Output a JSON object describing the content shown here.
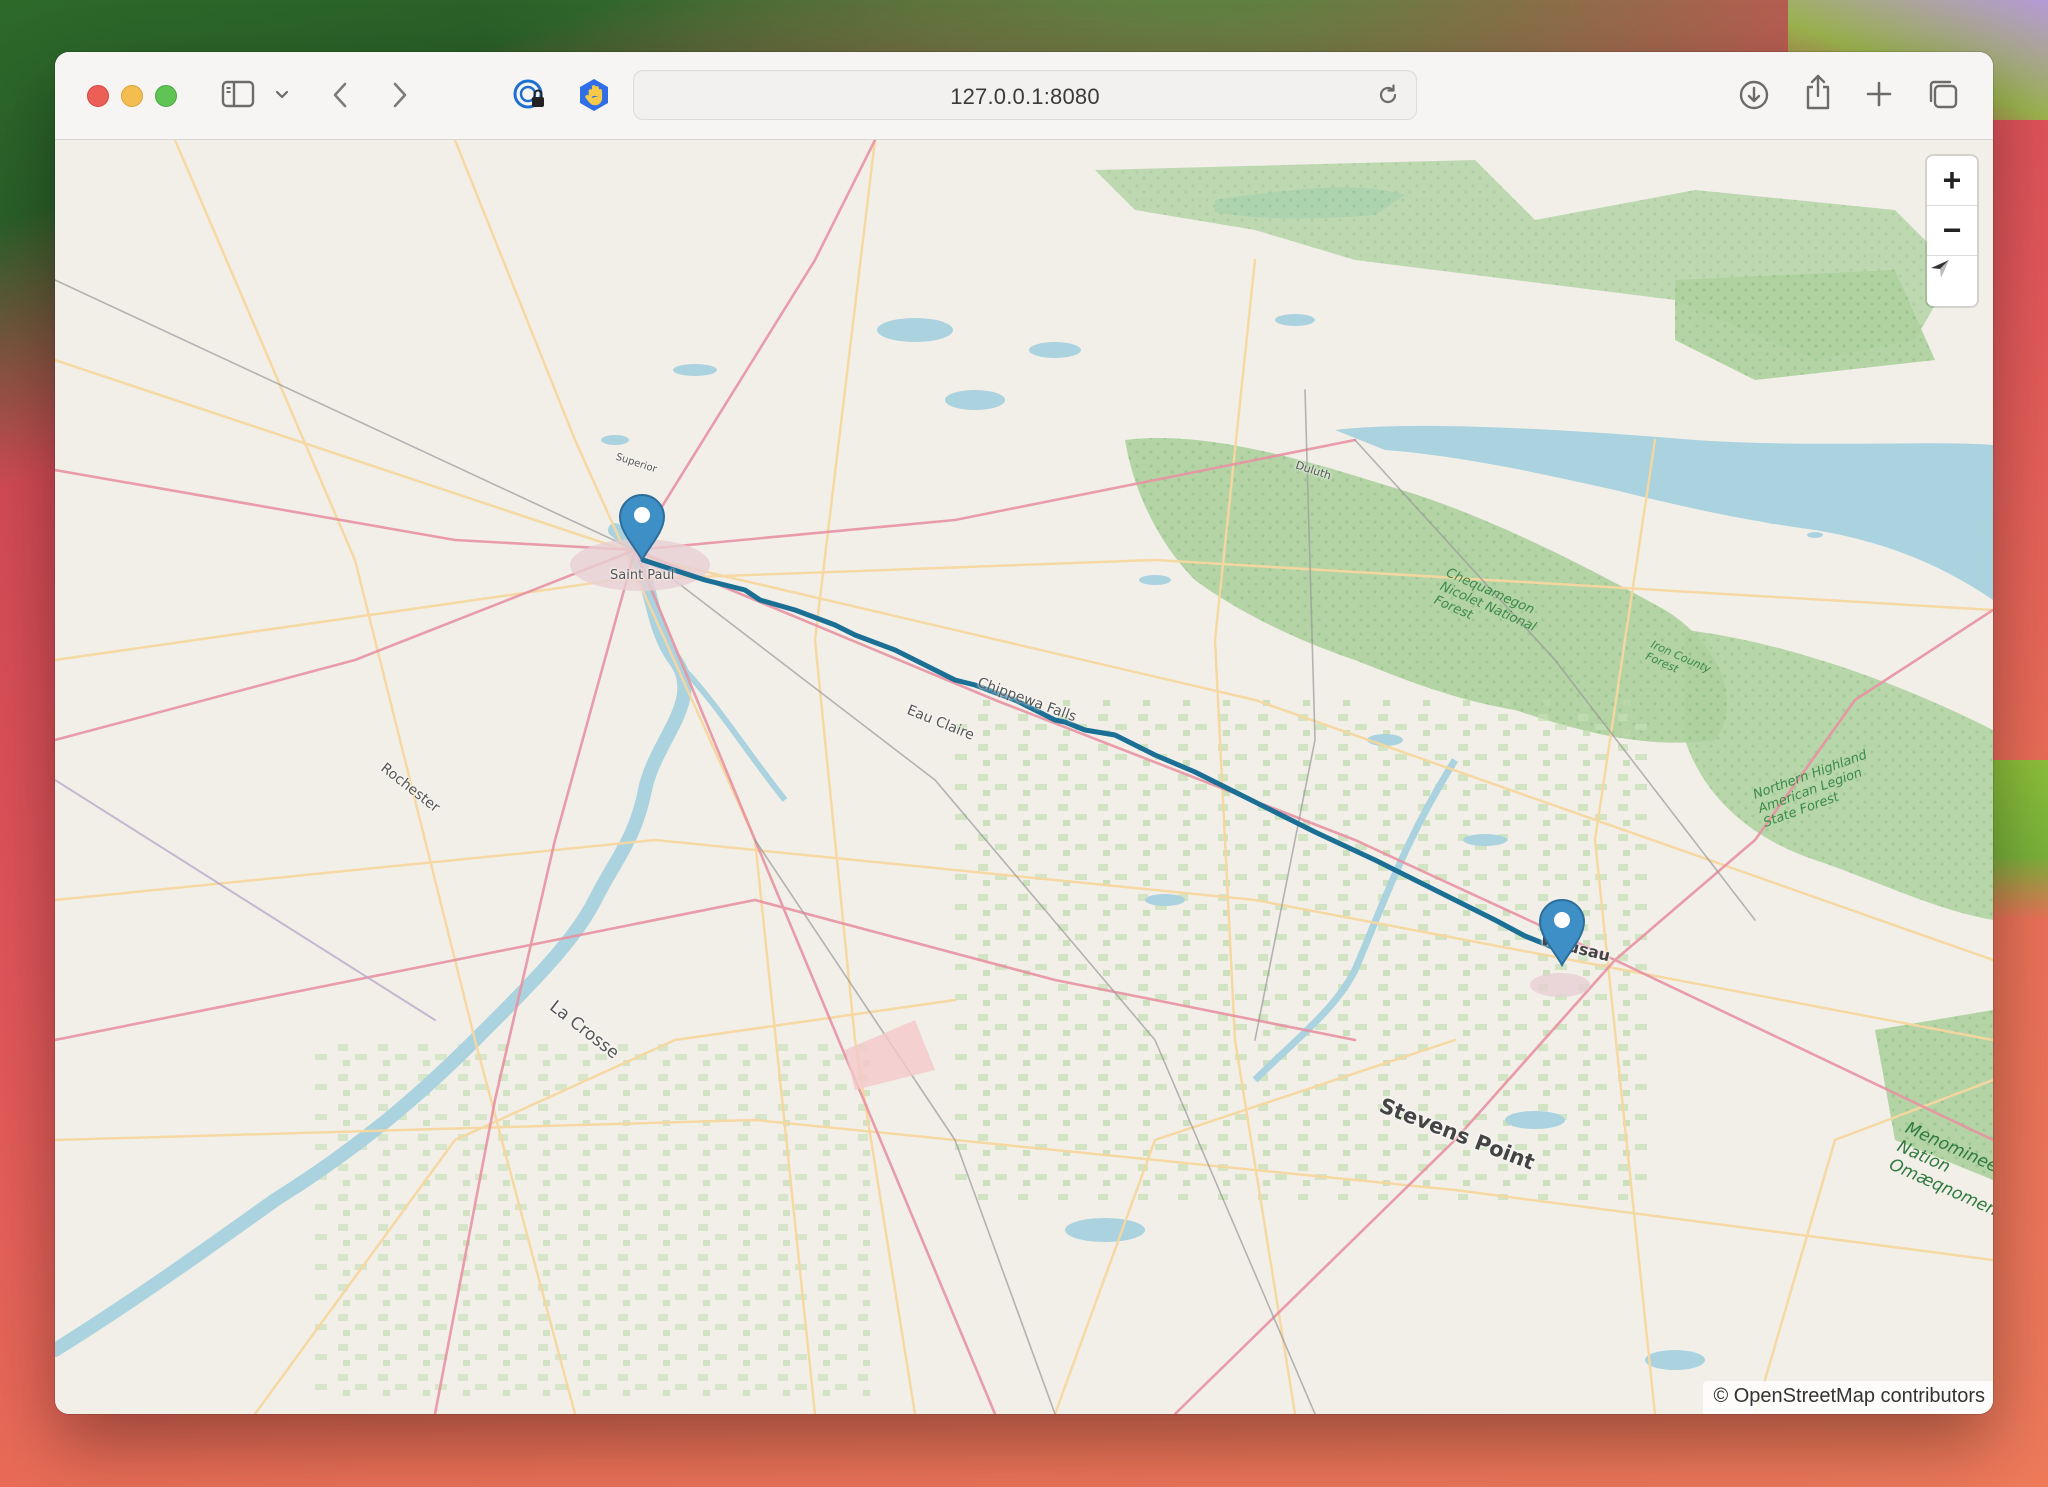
{
  "browser": {
    "url": "127.0.0.1:8080"
  },
  "icons": [
    "sidebar-icon",
    "chevron-down-icon",
    "back-icon",
    "forward-icon",
    "password-icon",
    "privacy-hand-icon",
    "reload-icon",
    "download-icon",
    "share-icon",
    "new-tab-icon",
    "tabs-overview-icon",
    "zoom-in-icon",
    "zoom-out-icon",
    "compass-icon"
  ],
  "map": {
    "zoom_in_label": "+",
    "zoom_out_label": "−",
    "attribution": "© OpenStreetMap contributors",
    "colors": {
      "route": "#1b6f95",
      "marker": "#3e8fc5",
      "water": "#aad3df",
      "forest": "#add19e",
      "land": "#f2efe9"
    },
    "labels": {
      "saint_paul": "Saint Paul",
      "chippewa_falls": "Chippewa Falls",
      "eau_claire": "Eau Claire",
      "rochester": "Rochester",
      "la_crosse": "La Crosse",
      "stevens_point": "Stevens Point",
      "wausau": "Wausau",
      "superior": "Superior",
      "duluth": "Duluth",
      "chequamegon": "Chequamegon Nicolet National Forest",
      "iron_county": "Iron County Forest",
      "northern_highland": "Northern Highland American Legion State Forest",
      "menominee": "Menominee Nation Omæqnomenew"
    },
    "markers": [
      {
        "name": "start-marker",
        "place": "Saint Paul"
      },
      {
        "name": "end-marker",
        "place": "Wausau"
      }
    ]
  }
}
